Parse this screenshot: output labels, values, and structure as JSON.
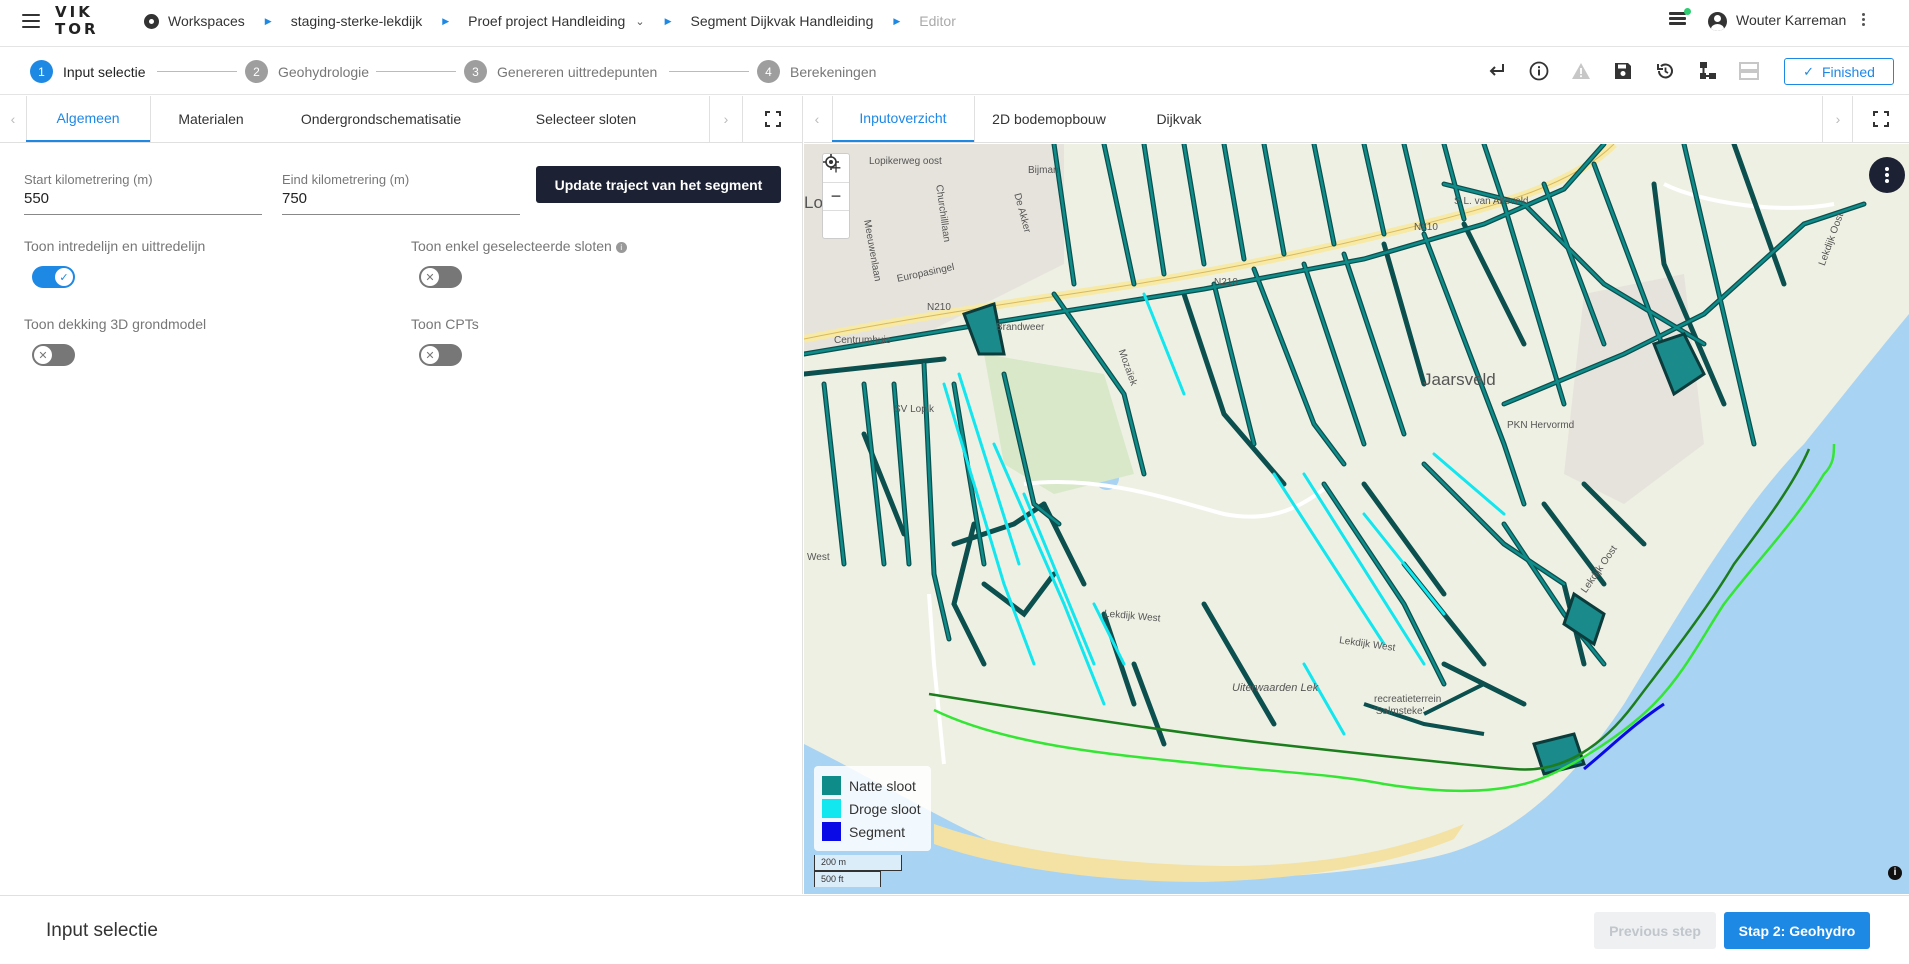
{
  "header": {
    "logo_line1": "VIK",
    "logo_line2": "TOR",
    "breadcrumbs": [
      {
        "label": "Workspaces"
      },
      {
        "label": "staging-sterke-lekdijk"
      },
      {
        "label": "Proef project Handleiding"
      },
      {
        "label": "Segment Dijkvak Handleiding"
      },
      {
        "label": "Editor"
      }
    ],
    "user_name": "Wouter Karreman"
  },
  "stepper": {
    "steps": [
      {
        "num": "1",
        "label": "Input selectie"
      },
      {
        "num": "2",
        "label": "Geohydrologie"
      },
      {
        "num": "3",
        "label": "Genereren uittredepunten"
      },
      {
        "num": "4",
        "label": "Berekeningen"
      }
    ],
    "finished_label": "Finished"
  },
  "left": {
    "tabs": [
      "Algemeen",
      "Materialen",
      "Ondergrondschematisatie",
      "Selecteer sloten"
    ],
    "start_label": "Start kilometrering (m)",
    "start_value": "550",
    "end_label": "Eind kilometrering (m)",
    "end_value": "750",
    "update_button": "Update traject van het segment",
    "toggles": [
      {
        "label": "Toon intredelijn en uittredelijn",
        "on": true
      },
      {
        "label": "Toon enkel geselecteerde sloten",
        "on": false
      },
      {
        "label": "Toon dekking 3D grondmodel",
        "on": false
      },
      {
        "label": "Toon CPTs",
        "on": false
      }
    ]
  },
  "right": {
    "tabs": [
      "Inputoverzicht",
      "2D bodemopbouw",
      "Dijkvak"
    ]
  },
  "map": {
    "labels": {
      "lopikerweg": "Lopikerweg oost",
      "bijman": "Bijman",
      "de_akker": "De Akker",
      "lopik": "Lopik",
      "churchilllaan": "Churchilllaan",
      "meeuwenlaan": "Meeuwenlaan",
      "europasingel": "Europasingel",
      "jaarsveld": "Jaarsveld",
      "pkn": "PKN Hervormd",
      "brandweer": "Brandweer",
      "lekdijk_west": "Lekdijk West",
      "lekdijk_west2": "Lekdijk West",
      "lekdijk_oost": "Lekdijk Oost",
      "lekdijk_oost2": "Lekdijk Oost",
      "uiterwaarden": "Uiterwaarden Lek",
      "recreatie": "recreatieterrein 'Salmsteke'",
      "west": "West",
      "n210a": "N210",
      "n210b": "N210",
      "n210c": "N210",
      "slvan": "S.L. van Alteveld",
      "mozaiek": "Mozaïek",
      "centrumhuis": "Centrumhuis",
      "sv_lopik": "SV Lopik"
    },
    "legend": [
      {
        "label": "Natte sloot",
        "color": "#0e8c8a"
      },
      {
        "label": "Droge sloot",
        "color": "#12e6ef"
      },
      {
        "label": "Segment",
        "color": "#0a0ae6"
      }
    ],
    "scale_m": "200 m",
    "scale_ft": "500 ft",
    "colors": {
      "water": "#a9d3f3",
      "land": "#eef0e3",
      "road": "#f7e9a6",
      "intrede": "#1b7d1b",
      "uittrede": "#34e534"
    }
  },
  "footer": {
    "title": "Input selectie",
    "prev": "Previous step",
    "next": "Stap 2: Geohydro"
  }
}
